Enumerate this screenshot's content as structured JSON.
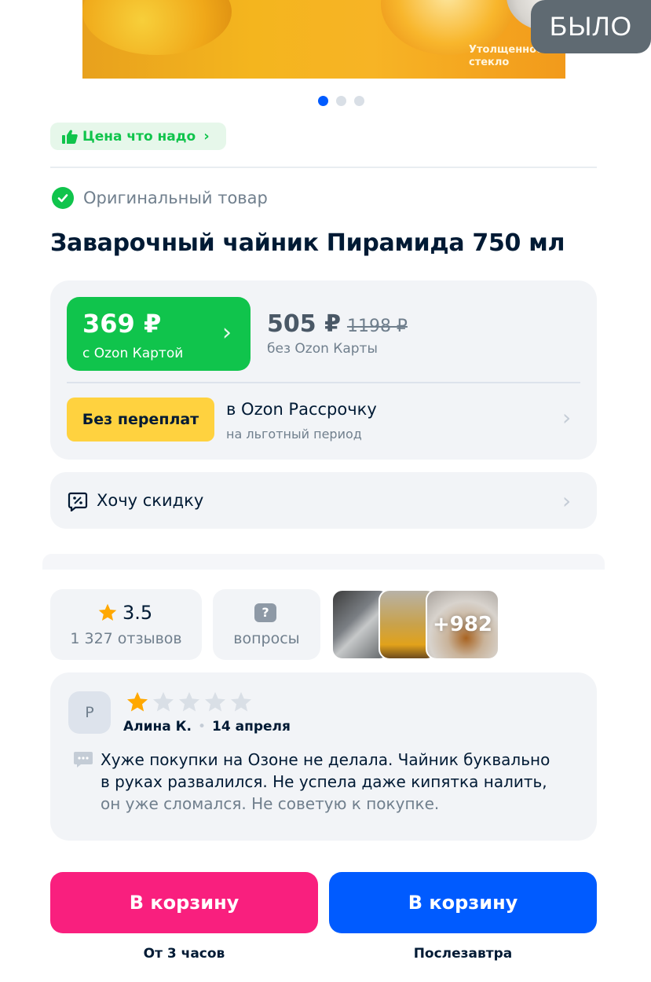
{
  "hero": {
    "caption": "Утолщенное стекло",
    "carousel_active_index": 0,
    "carousel_count": 3
  },
  "badge_was": "БЫЛО",
  "price_tag": {
    "label": "Цена что надо",
    "icon": "thumb-up-icon",
    "color": "#10c44c"
  },
  "original": {
    "label": "Оригинальный товар",
    "icon": "check-circle-icon"
  },
  "product": {
    "title": "Заварочный чайник Пирамида 750 мл"
  },
  "price": {
    "ozon_price": "369 ₽",
    "ozon_label": "с Ozon Картой",
    "regular_price": "505 ₽",
    "old_price": "1198 ₽",
    "regular_label": "без Ozon Карты",
    "accent": "#10c44c"
  },
  "installment": {
    "badge": "Без переплат",
    "title": "в Ozon Рассрочку",
    "subtitle": "на льготный период",
    "badge_color": "#ffd23f"
  },
  "discount": {
    "label": "Хочу скидку",
    "icon": "discount-tag-icon"
  },
  "rating": {
    "score": "3.5",
    "reviews_count": "1 327 отзывов",
    "icon": "star-icon"
  },
  "questions": {
    "label": "вопросы",
    "icon": "question-icon"
  },
  "photos": {
    "more_count": "+982"
  },
  "review": {
    "avatar_letter": "Р",
    "stars_filled": 1,
    "stars_total": 5,
    "author": "Алина К.",
    "date": "14 апреля",
    "text_line1": "Хуже покупки на Озоне не делала. Чайник буквально",
    "text_line2": "в руках развалился. Не успела даже кипятка налить,",
    "text_line3": "он уже сломался. Не советую к покупке."
  },
  "cart": {
    "left_label": "В корзину",
    "left_delivery": "От 3 часов",
    "left_color": "#f91f7e",
    "right_label": "В корзину",
    "right_delivery": "Послезавтра",
    "right_color": "#005bff"
  }
}
